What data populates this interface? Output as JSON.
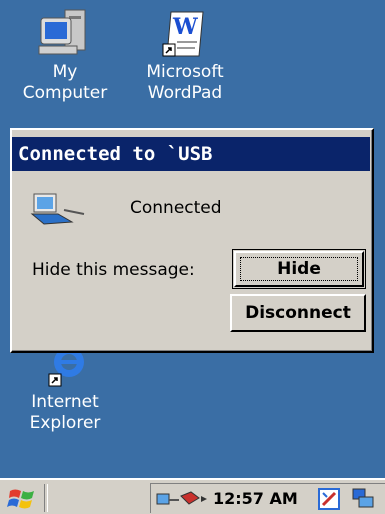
{
  "desktop": {
    "icons": [
      {
        "label": "My\nComputer",
        "icon": "my-computer-icon"
      },
      {
        "label": "Microsoft\nWordPad",
        "icon": "wordpad-icon"
      },
      {
        "label": "Internet\nExplorer",
        "icon": "internet-explorer-icon"
      }
    ]
  },
  "dialog": {
    "title": "Connected to `USB",
    "status_text": "Connected",
    "hide_label": "Hide this message:",
    "hide_button": "Hide",
    "disconnect_button": "Disconnect"
  },
  "taskbar": {
    "start_icon": "windows-start-icon",
    "clock": "12:57 AM",
    "colors": {
      "desktop": "#3a6ea5",
      "titlebar": "#0a246a",
      "face": "#d4d0c8"
    }
  }
}
